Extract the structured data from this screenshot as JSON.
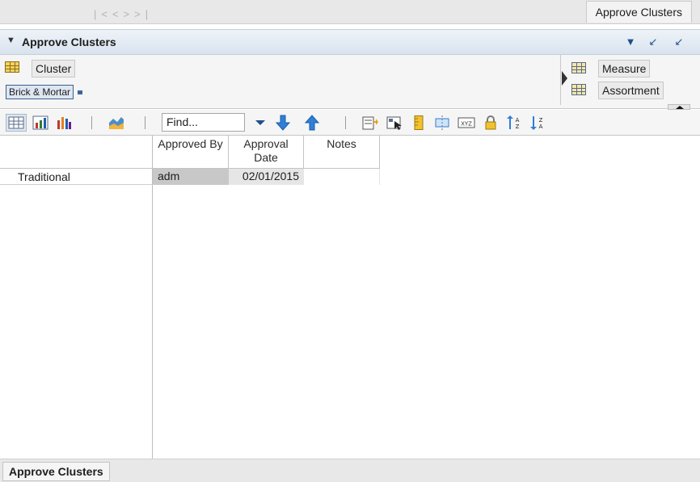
{
  "top_tab": {
    "label": "Approve Clusters"
  },
  "panel": {
    "title": "Approve Clusters"
  },
  "pivot": {
    "row_tile": "Cluster",
    "row_member": "Brick & Mortar",
    "col_tiles": [
      "Measure",
      "Assortment"
    ]
  },
  "toolbar": {
    "find_value": "Find...",
    "icons": [
      "grid-view-icon",
      "chart-grid-icon",
      "bar-chart-icon",
      "area-chart-icon",
      "find-dropdown-icon",
      "find-next-icon",
      "find-previous-icon",
      "export-icon",
      "select-icon",
      "ruler-icon",
      "split-icon",
      "xyz-icon",
      "lock-icon",
      "sort-ascending-icon",
      "sort-descending-icon"
    ]
  },
  "grid": {
    "columns": [
      "Approved By",
      "Approval\nDate",
      "Notes"
    ],
    "rows": [
      {
        "label": "Traditional",
        "cells": [
          "adm",
          "02/01/2015",
          ""
        ]
      }
    ]
  },
  "bottom_tab": {
    "label": "Approve Clusters"
  }
}
